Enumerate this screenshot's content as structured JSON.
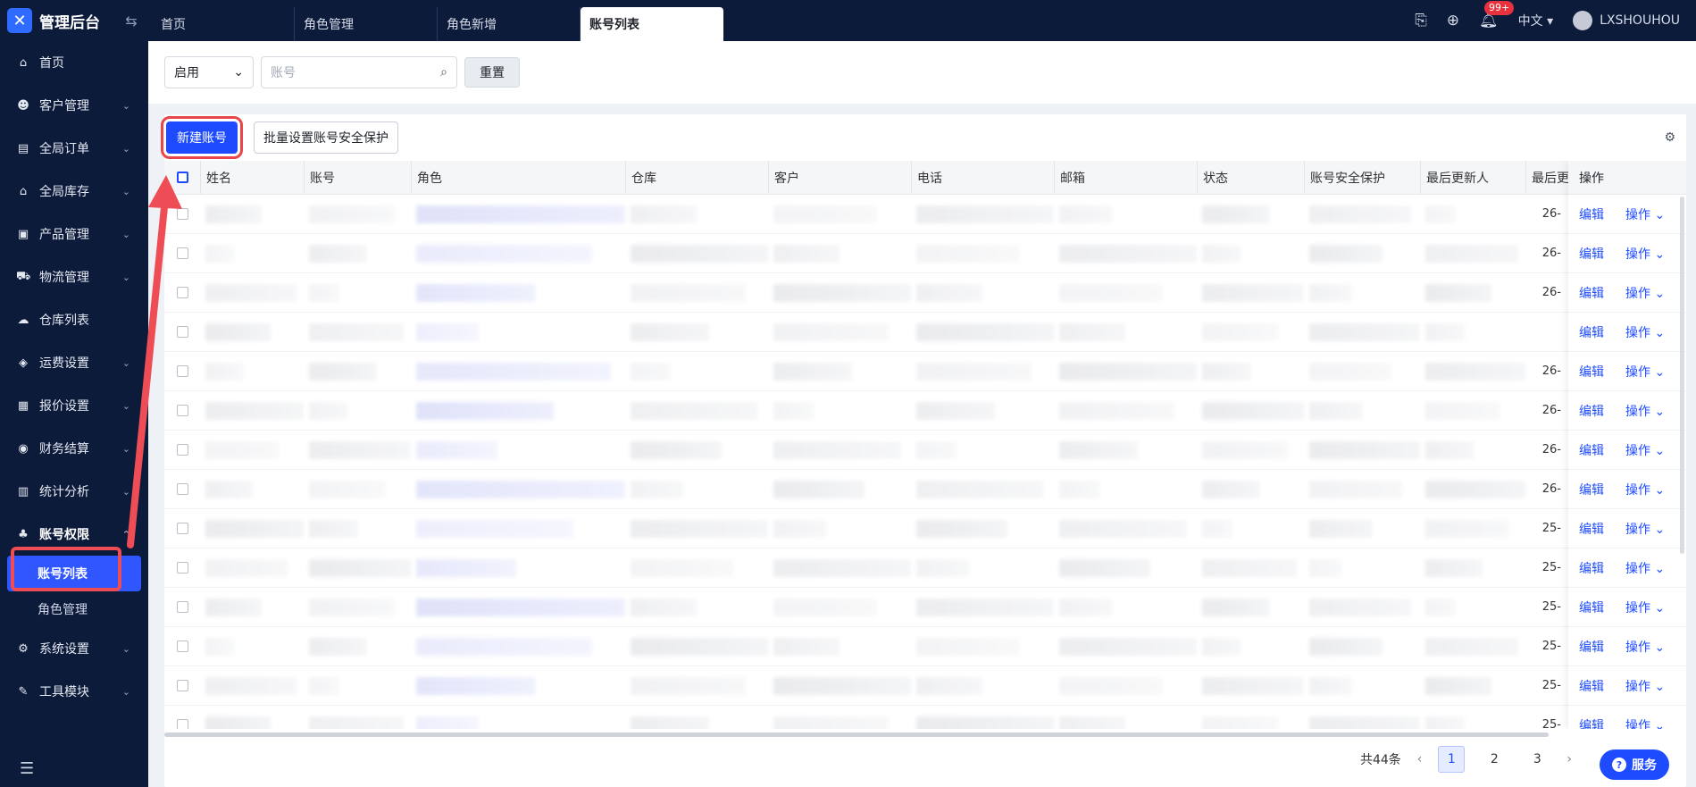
{
  "app": {
    "title": "管理后台"
  },
  "tabs": [
    {
      "label": "首页"
    },
    {
      "label": "角色管理"
    },
    {
      "label": "角色新增"
    },
    {
      "label": "账号列表"
    }
  ],
  "header": {
    "badge": "99+",
    "language": "中文",
    "username": "LXSHOUHOU"
  },
  "sidebar": {
    "items": [
      {
        "label": "首页",
        "icon": "home-icon"
      },
      {
        "label": "客户管理",
        "icon": "users-icon"
      },
      {
        "label": "全局订单",
        "icon": "clipboard-icon"
      },
      {
        "label": "全局库存",
        "icon": "warehouse-icon"
      },
      {
        "label": "产品管理",
        "icon": "box-icon"
      },
      {
        "label": "物流管理",
        "icon": "truck-icon"
      },
      {
        "label": "仓库列表",
        "icon": "cloud-icon"
      },
      {
        "label": "运费设置",
        "icon": "package-icon"
      },
      {
        "label": "报价设置",
        "icon": "document-icon"
      },
      {
        "label": "财务结算",
        "icon": "coin-icon"
      },
      {
        "label": "统计分析",
        "icon": "chart-icon"
      },
      {
        "label": "账号权限",
        "icon": "org-icon"
      }
    ],
    "sub_items": [
      {
        "label": "账号列表"
      },
      {
        "label": "角色管理"
      }
    ],
    "bottom_items": [
      {
        "label": "系统设置",
        "icon": "gear-icon"
      },
      {
        "label": "工具模块",
        "icon": "wrench-icon"
      }
    ]
  },
  "filter": {
    "status_value": "启用",
    "account_placeholder": "账号",
    "reset_label": "重置"
  },
  "toolbar": {
    "new_account": "新建账号",
    "bulk_security": "批量设置账号安全保护"
  },
  "table": {
    "columns": [
      "姓名",
      "账号",
      "角色",
      "仓库",
      "客户",
      "电话",
      "邮箱",
      "状态",
      "账号安全保护",
      "最后更新人",
      "最后更"
    ],
    "action_header": "操作",
    "edit_label": "编辑",
    "ops_label": "操作",
    "date_fragments": [
      "26-",
      "26-",
      "26-",
      "",
      "26-",
      "26-",
      "26-",
      "26-",
      "25-",
      "25-",
      "25-",
      "25-",
      "25-",
      "25-"
    ]
  },
  "pagination": {
    "total": "共44条",
    "pages": [
      "1",
      "2",
      "3"
    ]
  },
  "help": {
    "label": "服务"
  }
}
